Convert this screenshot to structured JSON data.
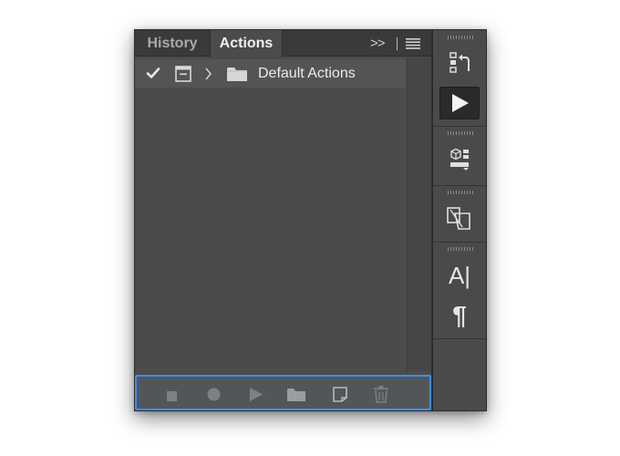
{
  "tabs": {
    "history_label": "History",
    "actions_label": "Actions",
    "collapse_label": ">>"
  },
  "actions_list": {
    "items": [
      {
        "label": "Default Actions",
        "enabled": true,
        "type": "action-set"
      }
    ]
  },
  "footer": {
    "buttons": [
      "stop-icon",
      "record-icon",
      "play-icon",
      "folder-icon",
      "new-action-icon",
      "trash-icon"
    ]
  },
  "dock": {
    "character_label": "A|",
    "paragraph_label": "¶",
    "buttons": [
      "history-icon",
      "actions-play-icon",
      "3d-icon",
      "transform-icon",
      "character-icon",
      "paragraph-icon"
    ]
  },
  "colors": {
    "panel_bg": "#4b4b4b",
    "tabbar_bg": "#3a3a3a",
    "selection_outline": "#3d8ef2",
    "text": "#ececec"
  }
}
